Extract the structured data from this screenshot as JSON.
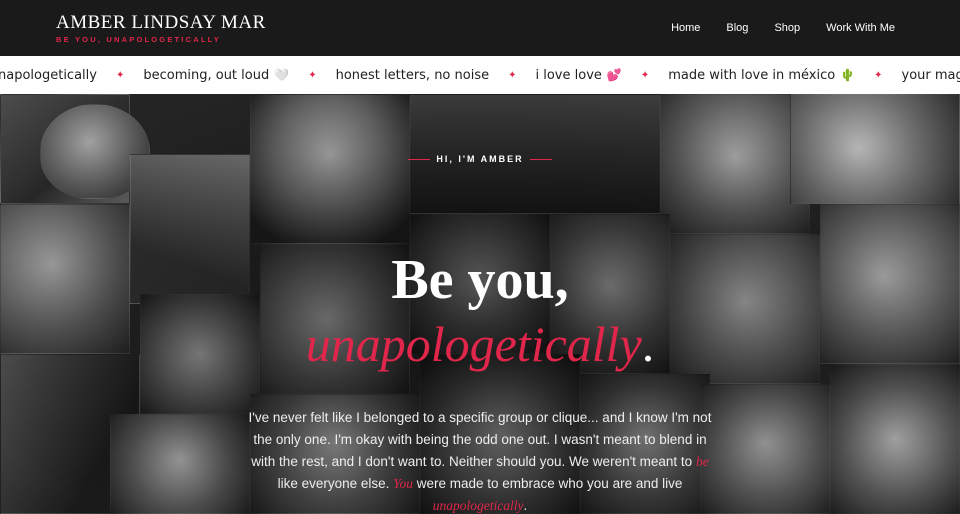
{
  "header": {
    "brand_name": "AMBER LINDSAY MAR",
    "brand_tagline": "BE YOU, UNAPOLOGETICALLY",
    "nav": [
      {
        "label": "Home"
      },
      {
        "label": "Blog"
      },
      {
        "label": "Shop"
      },
      {
        "label": "Work With Me"
      }
    ]
  },
  "ticker": {
    "items": [
      {
        "text": "napologetically",
        "emoji": ""
      },
      {
        "text": "becoming, out loud",
        "emoji": "🤍"
      },
      {
        "text": "honest letters, no noise",
        "emoji": ""
      },
      {
        "text": "i love love",
        "emoji": "💕"
      },
      {
        "text": "made with love in méxico",
        "emoji": "🌵"
      },
      {
        "text": "your magic matters",
        "emoji": "✨"
      }
    ],
    "separator": "✦"
  },
  "hero": {
    "eyebrow": "HI, I'M AMBER",
    "headline": "Be you,",
    "headline_accent": "unapologetically",
    "headline_dot": ".",
    "paragraph_1": "I've never felt like I belonged to a specific group or clique... and I know I'm not the only one. I'm okay with being the odd one out. I wasn't meant to blend in with the rest, and I don't want to. Neither should you. We weren't meant to ",
    "paragraph_em1": "be",
    "paragraph_2": " like everyone else. ",
    "paragraph_em2": "You",
    "paragraph_3": " were made to embrace who you are and live ",
    "paragraph_em3": "unapologetically",
    "paragraph_4": "."
  },
  "colors": {
    "accent": "#e0264a",
    "header_bg": "#1a1a1a",
    "ticker_bg": "#ffffff"
  }
}
